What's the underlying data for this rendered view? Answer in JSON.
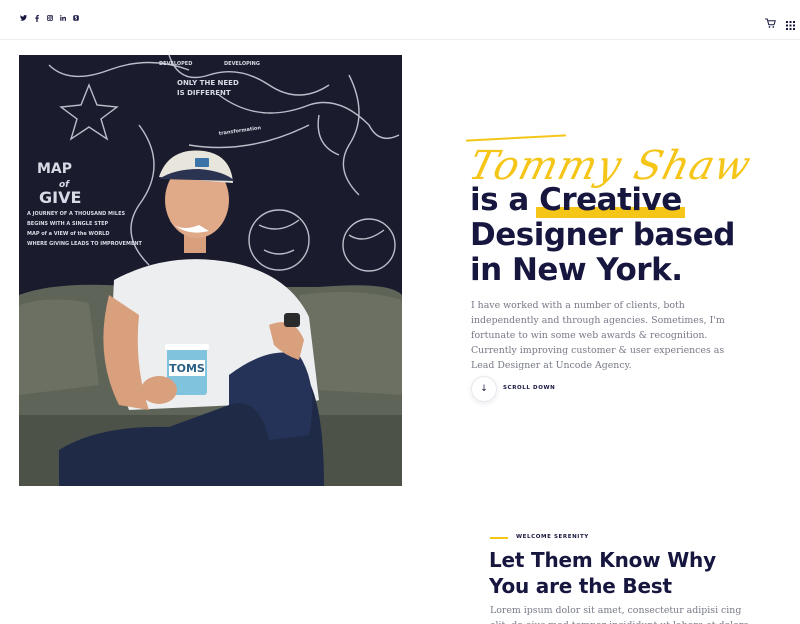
{
  "header": {
    "social_icons": [
      {
        "name": "twitter-icon",
        "glyph": "🐦"
      },
      {
        "name": "facebook-icon",
        "glyph": "f"
      },
      {
        "name": "instagram-icon",
        "glyph": "◘"
      },
      {
        "name": "linkedin-icon",
        "glyph": "in"
      },
      {
        "name": "skype-icon",
        "glyph": "S"
      }
    ],
    "cart_icon": "cart-icon",
    "menu_icon": "grid-menu-icon"
  },
  "hero": {
    "signature": "Tommy Shaw",
    "headline_prefix": "is a ",
    "headline_highlight": "Creative",
    "headline_line2": "Designer based",
    "headline_line3": "in New York.",
    "intro": "I have worked with a number of clients, both independently and through agencies. Sometimes, I'm fortunate to win some web awards & recognition. Currently improving customer & user experiences as Lead Designer at Uncode Agency.",
    "scroll_arrow": "↓",
    "scroll_label": "SCROLL DOWN"
  },
  "section": {
    "eyebrow": "WELCOME SERENITY",
    "title_line1": "Let Them Know Why",
    "title_line2": "You are the Best",
    "text": "Lorem ipsum dolor sit amet, consectetur adipisi cing elit, do eius mod tempor incididunt ut labore et dolore magna"
  },
  "colors": {
    "accent": "#f5c518",
    "navy": "#16163f",
    "body_text": "#777a86"
  }
}
